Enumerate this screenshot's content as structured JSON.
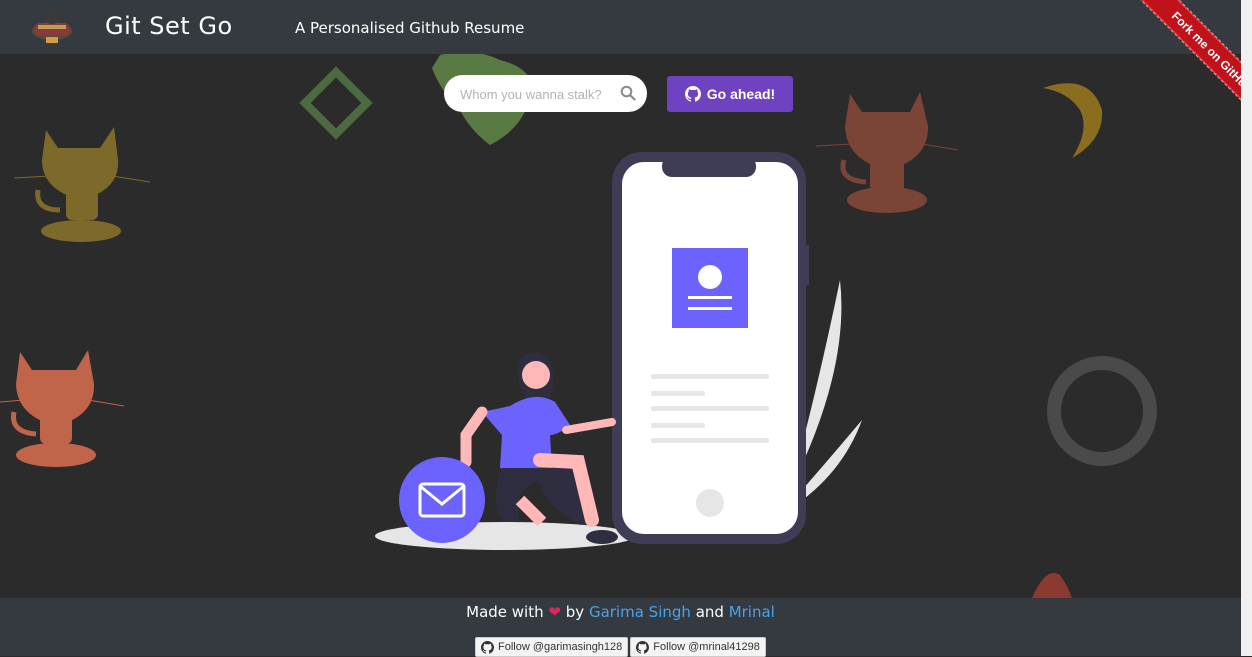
{
  "header": {
    "brand": "Git Set Go",
    "tagline": "A Personalised Github Resume",
    "logo_icon": "octocat-logo-icon"
  },
  "search": {
    "placeholder": "Whom you wanna stalk?",
    "value": "",
    "icon": "search-icon"
  },
  "go_button": {
    "label": "Go ahead!",
    "icon": "github-icon"
  },
  "ribbon": {
    "label": "Fork me on GitHub"
  },
  "footer": {
    "made_with": "Made with",
    "heart_icon": "heart-icon",
    "by": "by",
    "author1": "Garima Singh",
    "and": "and",
    "author2": "Mrinal",
    "follow_buttons": [
      {
        "label": "Follow @garimasingh128",
        "icon": "github-icon"
      },
      {
        "label": "Follow @mrinal41298",
        "icon": "github-icon"
      }
    ]
  },
  "colors": {
    "navbar": "#343a40",
    "background": "#2b2b2c",
    "accent": "#6f42c1",
    "illustration_purple": "#6c63ff",
    "author_link": "#4aa3e8",
    "ribbon": "#c0121b"
  }
}
